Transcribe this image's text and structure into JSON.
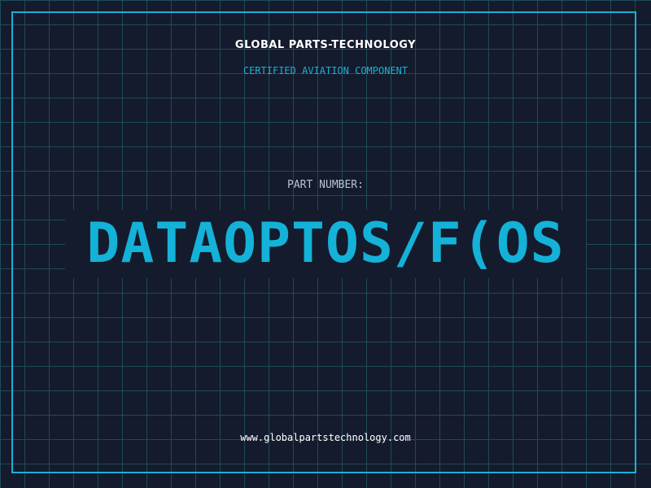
{
  "header": {
    "company_name": "GLOBAL PARTS-TECHNOLOGY",
    "tagline": "CERTIFIED AVIATION COMPONENT"
  },
  "part": {
    "label": "PART NUMBER:",
    "number": "DATAOPTOS/F(OS"
  },
  "footer": {
    "website": "www.globalpartstechnology.com"
  },
  "colors": {
    "background": "#141b2c",
    "grid": "#1f4a5a",
    "accent": "#1ab0d6",
    "text": "#ffffff",
    "muted": "#b9c3d3"
  }
}
